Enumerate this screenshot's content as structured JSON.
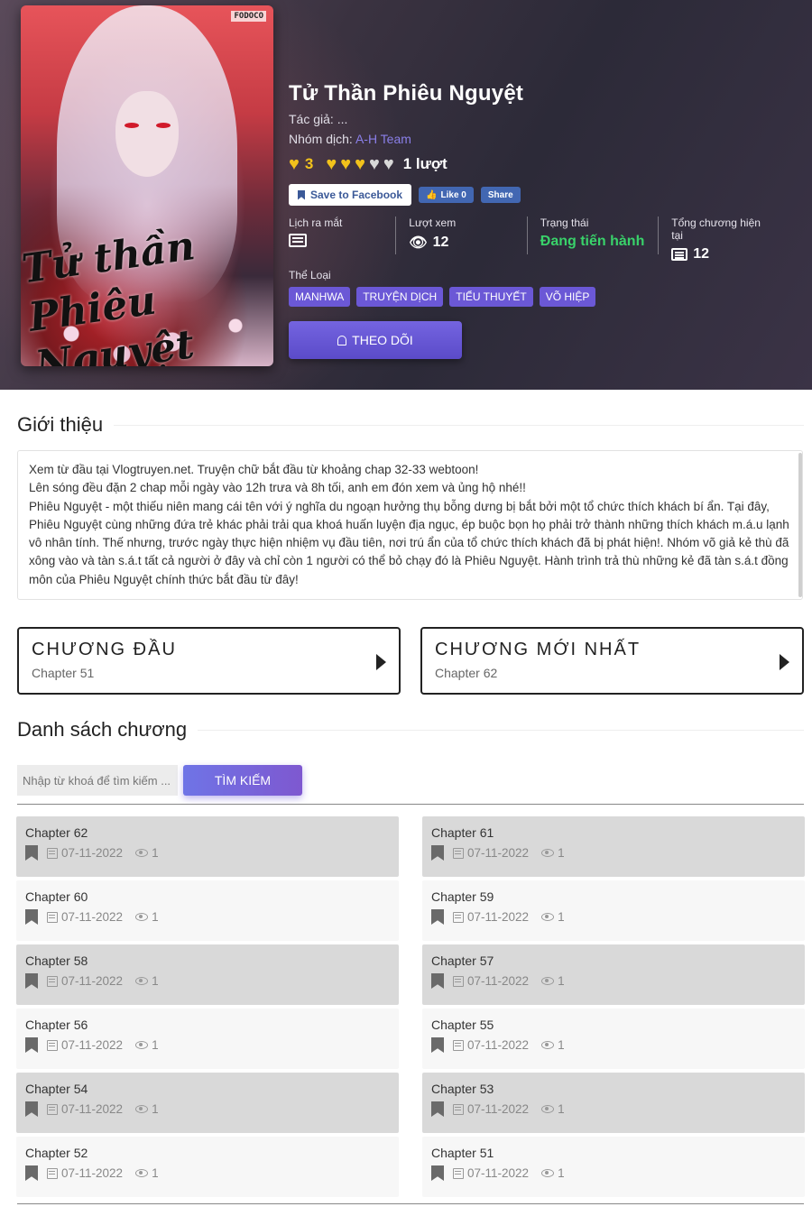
{
  "manga": {
    "title": "Tử Thần Phiêu Nguyệt",
    "author_label": "Tác giả: ...",
    "translator_label": "Nhóm dịch:",
    "translator_name": "A-H Team",
    "rating_value": "3",
    "hearts_filled": 3,
    "hearts_total": 5,
    "votes": "1 lượt",
    "cover_logo": "FODOCO",
    "cover_title_art": "Tử thần Phiêu Nguyệt"
  },
  "social": {
    "save_fb": "Save to Facebook",
    "like": "Like 0",
    "share": "Share"
  },
  "stats": {
    "release_label": "Lịch ra mắt",
    "views_label": "Lượt xem",
    "views_value": "12",
    "status_label": "Trạng thái",
    "status_value": "Đang tiến hành",
    "chapters_label": "Tổng chương hiện tại",
    "chapters_value": "12"
  },
  "genres_label": "Thể Loại",
  "genres": [
    "MANHWA",
    "TRUYỆN DỊCH",
    "TIỂU THUYẾT",
    "VÕ HIỆP"
  ],
  "follow_label": "THEO DÕI",
  "intro": {
    "heading": "Giới thiệu",
    "lines": [
      "Xem từ đầu tại Vlogtruyen.net. Truyện chữ bắt đầu từ khoảng chap 32-33 webtoon!",
      "Lên sóng đều đặn 2 chap mỗi ngày vào 12h trưa và 8h tối, anh em đón xem và ủng hộ nhé!!",
      "Phiêu Nguyệt - một thiếu niên mang cái tên với ý nghĩa du ngoạn hưởng thụ bỗng dưng bị bắt bởi một tổ chức thích khách bí ẩn. Tại đây, Phiêu Nguyệt cùng những đứa trẻ khác phải trải qua khoá huấn luyện địa ngục, ép buộc bọn họ phải trở thành những thích khách m.á.u lạnh vô nhân tính. Thế nhưng, trước ngày thực hiện nhiệm vụ đầu tiên, nơi trú ẩn của tổ chức thích khách đã bị phát hiện!. Nhóm võ giả kẻ thù đã xông vào và tàn s.á.t tất cả người ở đây và chỉ còn 1 người có thể bỏ chạy đó là Phiêu Nguyệt. Hành trình trả thù những kẻ đã tàn s.á.t đồng môn của Phiêu Nguyệt chính thức bắt đầu từ đây!"
    ]
  },
  "first_chapter": {
    "label": "CHƯƠNG ĐẦU",
    "chapter": "Chapter 51"
  },
  "latest_chapter": {
    "label": "CHƯƠNG MỚI NHẤT",
    "chapter": "Chapter 62"
  },
  "chapter_list": {
    "heading": "Danh sách chương",
    "search_placeholder": "Nhập từ khoá để tìm kiếm ...",
    "search_button": "TÌM KIẾM",
    "items": [
      {
        "name": "Chapter 62",
        "date": "07-11-2022",
        "views": "1"
      },
      {
        "name": "Chapter 61",
        "date": "07-11-2022",
        "views": "1"
      },
      {
        "name": "Chapter 60",
        "date": "07-11-2022",
        "views": "1"
      },
      {
        "name": "Chapter 59",
        "date": "07-11-2022",
        "views": "1"
      },
      {
        "name": "Chapter 58",
        "date": "07-11-2022",
        "views": "1"
      },
      {
        "name": "Chapter 57",
        "date": "07-11-2022",
        "views": "1"
      },
      {
        "name": "Chapter 56",
        "date": "07-11-2022",
        "views": "1"
      },
      {
        "name": "Chapter 55",
        "date": "07-11-2022",
        "views": "1"
      },
      {
        "name": "Chapter 54",
        "date": "07-11-2022",
        "views": "1"
      },
      {
        "name": "Chapter 53",
        "date": "07-11-2022",
        "views": "1"
      },
      {
        "name": "Chapter 52",
        "date": "07-11-2022",
        "views": "1"
      },
      {
        "name": "Chapter 51",
        "date": "07-11-2022",
        "views": "1"
      }
    ]
  },
  "colors": {
    "accent": "#6b58d6",
    "heart_on": "#f2c21b",
    "heart_off": "#d8d8d8",
    "status_green": "#39d26a",
    "row_dark": "#d9d9d9",
    "row_light": "#f7f7f7"
  },
  "icons": {
    "heart": "heart-icon",
    "bookmark": "bookmark-icon",
    "calendar": "calendar-icon",
    "eye": "eye-icon",
    "bell": "bell-icon",
    "list": "list-icon"
  }
}
